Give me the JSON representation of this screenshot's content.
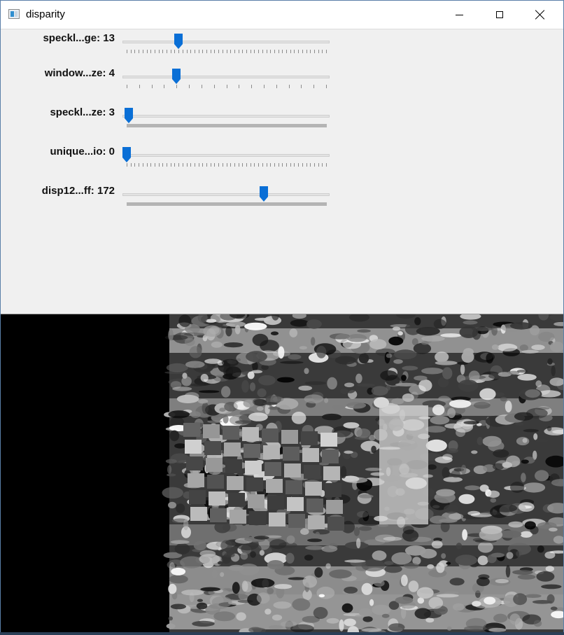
{
  "window": {
    "title": "disparity",
    "icon": "opencv-window-icon",
    "controls": [
      "minimize-icon",
      "maximize-icon",
      "close-icon"
    ]
  },
  "trackbars": [
    {
      "label": "speckl...ge: 13",
      "value": 13,
      "max": 50,
      "tick_count": 51
    },
    {
      "label": "window...ze: 4",
      "value": 4,
      "max": 16,
      "tick_count": 17
    },
    {
      "label": "speckl...ze: 3",
      "value": 3,
      "max": 300,
      "tick_count": 301
    },
    {
      "label": "unique...io: 0",
      "value": 0,
      "max": 50,
      "tick_count": 51
    },
    {
      "label": "disp12...ff: 172",
      "value": 172,
      "max": 250,
      "tick_count": 1000
    }
  ],
  "image": {
    "type": "grayscale-disparity-map",
    "left_black_band_fraction": 0.3
  },
  "colors": {
    "thumb": "#0a6fd6",
    "track": "#e3e3e3",
    "panel": "#f0f0f0"
  }
}
